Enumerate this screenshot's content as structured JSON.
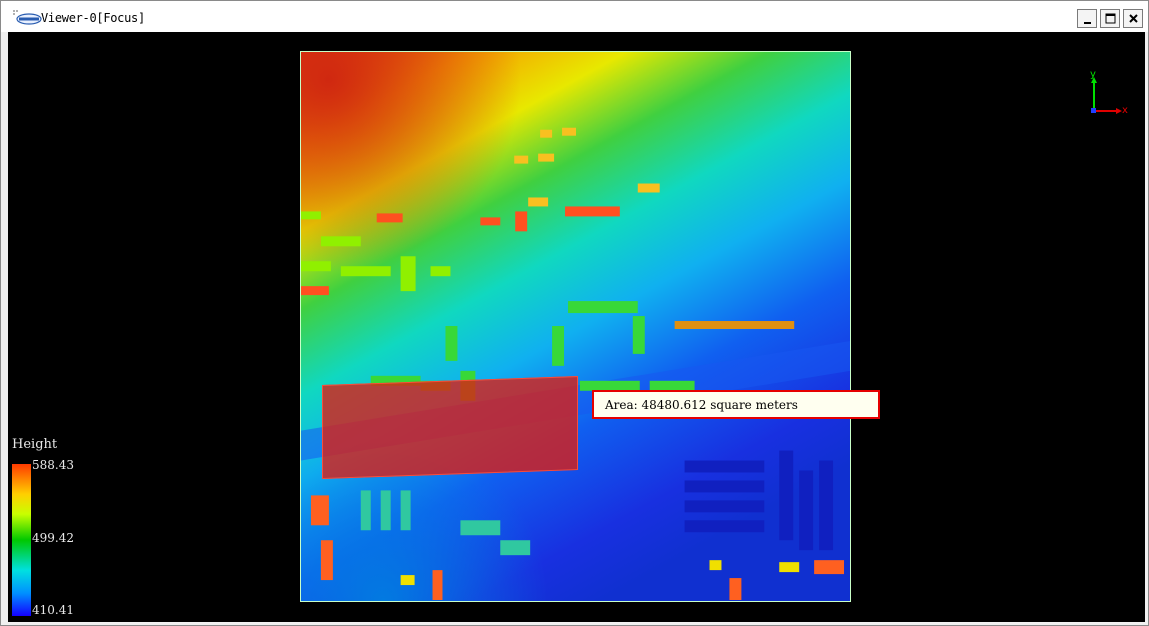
{
  "window": {
    "title": "Viewer-0[Focus]",
    "app_icon": "lidar-app-icon",
    "buttons": {
      "minimize": "minimize-icon",
      "maximize": "maximize-icon",
      "close": "close-icon"
    }
  },
  "viewer": {
    "background": "#000000",
    "measurement": {
      "text": "Area: 48480.612 square meters",
      "border_color": "#e60000"
    },
    "legend": {
      "title": "Height",
      "max": "588.43",
      "mid": "499.42",
      "min": "410.41",
      "colors": [
        "#ff3a00",
        "#ffd000",
        "#00c800",
        "#00e0e0",
        "#1400ff"
      ]
    },
    "axis": {
      "x_label": "x",
      "y_label": "y"
    }
  }
}
